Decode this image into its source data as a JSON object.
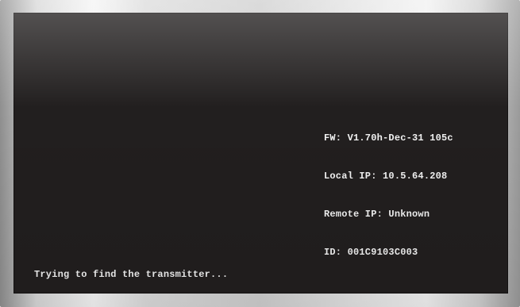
{
  "screen": {
    "status_message": "Trying to find the transmitter...",
    "device_info": {
      "firmware": "FW: V1.70h-Dec-31 105c",
      "local_ip": "Local IP: 10.5.64.208",
      "remote_ip": "Remote IP: Unknown",
      "id": "ID: 001C9103C003"
    }
  }
}
